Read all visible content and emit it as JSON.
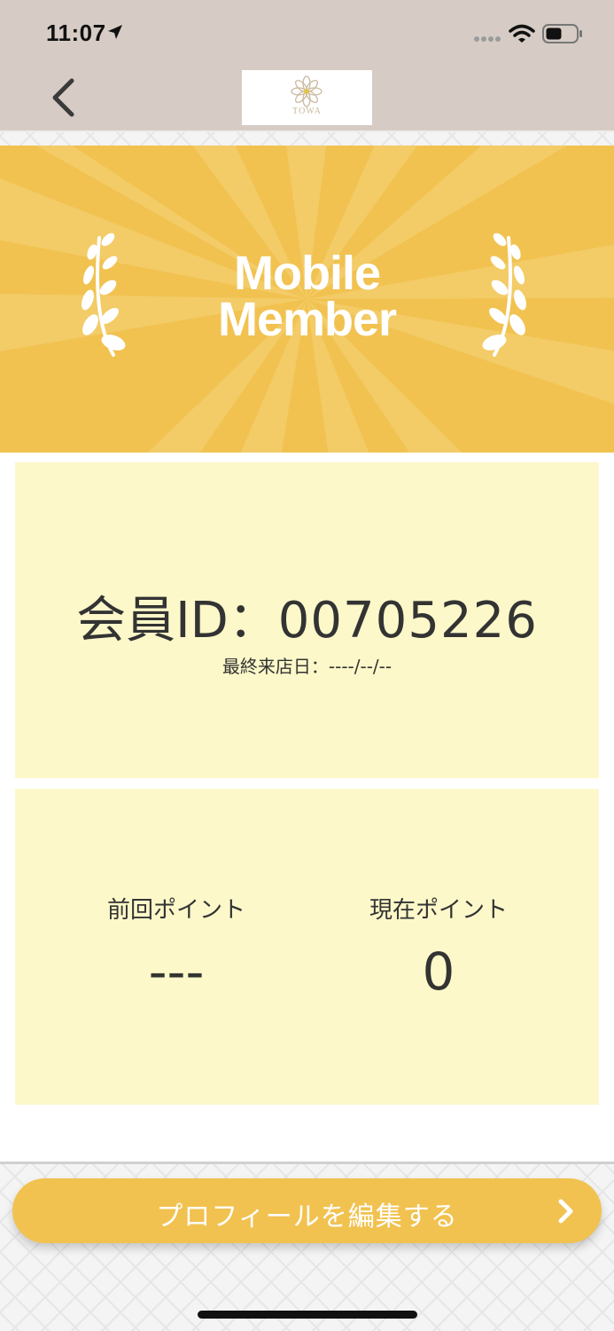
{
  "status_bar": {
    "time": "11:07"
  },
  "header": {
    "logo_text": "TOWA"
  },
  "banner": {
    "title_line1": "Mobile",
    "title_line2": "Member"
  },
  "member": {
    "id_label": "会員ID：",
    "id_value": "00705226",
    "last_visit": "最終来店日：----/--/--"
  },
  "points": {
    "previous_label": "前回ポイント",
    "previous_value": "---",
    "current_label": "現在ポイント",
    "current_value": "0"
  },
  "actions": {
    "edit_profile": "プロフィールを編集する"
  },
  "colors": {
    "accent": "#f1c250",
    "card": "#fcf8c9",
    "statusbar": "#d6ccc5"
  }
}
